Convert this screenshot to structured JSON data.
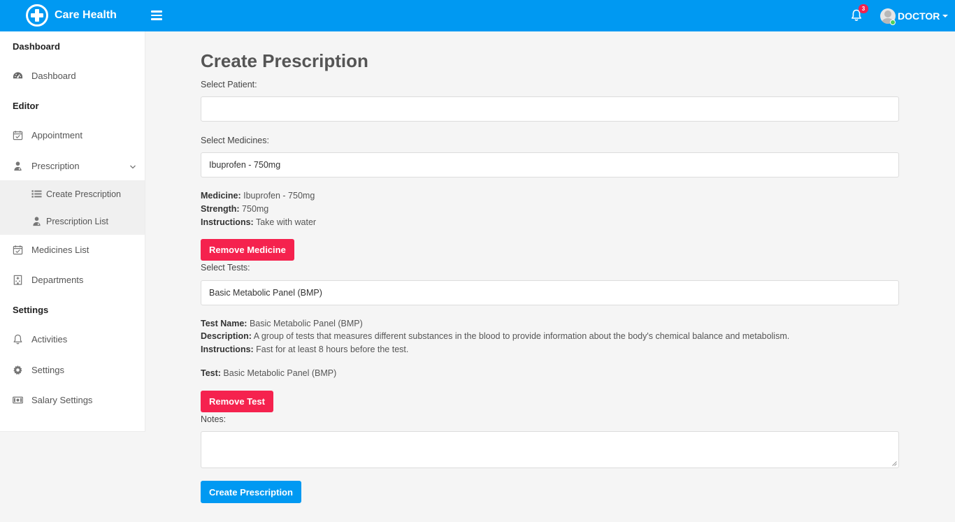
{
  "app": {
    "name": "Care Health"
  },
  "header": {
    "notification_count": "3",
    "user_label": "DOCTOR"
  },
  "sidebar": {
    "sections": {
      "dashboard": "Dashboard",
      "editor": "Editor",
      "settings": "Settings"
    },
    "items": {
      "dashboard": "Dashboard",
      "appointment": "Appointment",
      "prescription": "Prescription",
      "create_prescription": "Create Prescription",
      "prescription_list": "Prescription List",
      "medicines_list": "Medicines List",
      "departments": "Departments",
      "activities": "Activities",
      "settings": "Settings",
      "salary_settings": "Salary Settings"
    }
  },
  "form": {
    "title": "Create Prescription",
    "patient_label": "Select Patient:",
    "patient_value": "",
    "medicines_label": "Select Medicines:",
    "medicines_value": "Ibuprofen - 750mg",
    "medicine_info": {
      "medicine_key": "Medicine:",
      "medicine_val": " Ibuprofen - 750mg",
      "strength_key": "Strength:",
      "strength_val": " 750mg",
      "instructions_key": "Instructions:",
      "instructions_val": " Take with water"
    },
    "remove_medicine_label": "Remove Medicine",
    "tests_label": "Select Tests:",
    "tests_value": "Basic Metabolic Panel (BMP)",
    "test_info": {
      "name_key": "Test Name:",
      "name_val": " Basic Metabolic Panel (BMP)",
      "description_key": "Description:",
      "description_val": " A group of tests that measures different substances in the blood to provide information about the body's chemical balance and metabolism.",
      "instructions_key": "Instructions:",
      "instructions_val": " Fast for at least 8 hours before the test."
    },
    "test_summary_key": "Test:",
    "test_summary_val": " Basic Metabolic Panel (BMP)",
    "remove_test_label": "Remove Test",
    "notes_label": "Notes:",
    "notes_value": "",
    "submit_label": "Create Prescription"
  },
  "colors": {
    "primary": "#0099f2",
    "danger": "#f5224e",
    "online": "#4ccf5c"
  }
}
